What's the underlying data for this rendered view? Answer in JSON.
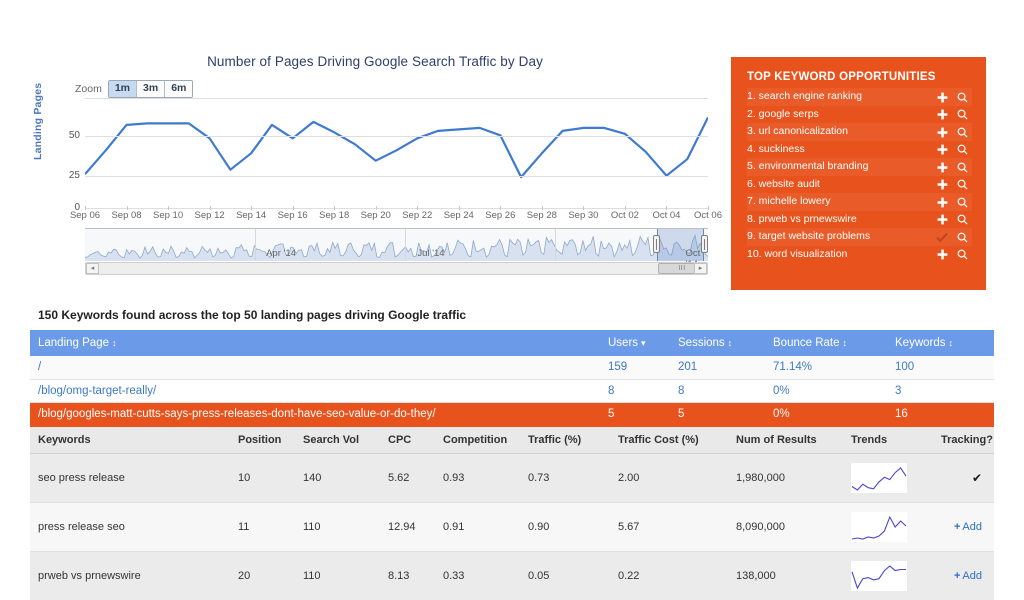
{
  "chart": {
    "title": "Number of Pages Driving Google Search Traffic by Day",
    "zoom_label": "Zoom",
    "zoom_buttons": [
      {
        "label": "1m",
        "active": true
      },
      {
        "label": "3m",
        "active": false
      },
      {
        "label": "6m",
        "active": false
      }
    ],
    "y_axis_title": "Landing Pages",
    "y_ticks": [
      "50",
      "25",
      "0"
    ],
    "navigator_labels": [
      "Apr '14",
      "Jul '14",
      "Oct '14"
    ],
    "scrollbar": {
      "left_arrow": "◂",
      "right_arrow": "▸",
      "grip": "III"
    }
  },
  "chart_data": {
    "type": "line",
    "title": "Number of Pages Driving Google Search Traffic by Day",
    "xlabel": "",
    "ylabel": "Landing Pages",
    "ylim": [
      0,
      75
    ],
    "y_ticks": [
      0,
      25,
      50
    ],
    "grid": true,
    "legend": "none",
    "x": [
      "Sep 06",
      "Sep 07",
      "Sep 08",
      "Sep 09",
      "Sep 10",
      "Sep 11",
      "Sep 12",
      "Sep 13",
      "Sep 14",
      "Sep 15",
      "Sep 16",
      "Sep 17",
      "Sep 18",
      "Sep 19",
      "Sep 20",
      "Sep 21",
      "Sep 22",
      "Sep 23",
      "Sep 24",
      "Sep 25",
      "Sep 26",
      "Sep 27",
      "Sep 28",
      "Sep 29",
      "Sep 30",
      "Oct 01",
      "Oct 02",
      "Oct 03",
      "Oct 04",
      "Oct 05",
      "Oct 06"
    ],
    "x_tick_labels": [
      "Sep 06",
      "Sep 08",
      "Sep 10",
      "Sep 12",
      "Sep 14",
      "Sep 16",
      "Sep 18",
      "Sep 20",
      "Sep 22",
      "Sep 24",
      "Sep 26",
      "Sep 28",
      "Sep 30",
      "Oct 02",
      "Oct 04",
      "Oct 06"
    ],
    "series": [
      {
        "name": "Landing Pages",
        "color": "#3e7ad1",
        "values": [
          24,
          40,
          57,
          58,
          58,
          58,
          48,
          27,
          38,
          57,
          48,
          59,
          52,
          44,
          33,
          40,
          48,
          53,
          54,
          55,
          50,
          22,
          38,
          53,
          55,
          55,
          51,
          39,
          23,
          34,
          62
        ]
      }
    ],
    "navigator": {
      "range_labels": [
        "Apr '14",
        "Jul '14",
        "Oct '14"
      ],
      "selection": "Sep 06 - Oct 06"
    }
  },
  "keyword_panel": {
    "title": "TOP KEYWORD OPPORTUNITIES",
    "items": [
      {
        "rank": "1.",
        "name": "search engine ranking",
        "action": "add",
        "search": "search-icon"
      },
      {
        "rank": "2.",
        "name": "google serps",
        "action": "add",
        "search": "search-icon"
      },
      {
        "rank": "3.",
        "name": "url canonicalization",
        "action": "add",
        "search": "search-icon"
      },
      {
        "rank": "4.",
        "name": "suckiness",
        "action": "add",
        "search": "search-icon"
      },
      {
        "rank": "5.",
        "name": "environmental branding",
        "action": "add",
        "search": "search-icon"
      },
      {
        "rank": "6.",
        "name": "website audit",
        "action": "add",
        "search": "search-icon"
      },
      {
        "rank": "7.",
        "name": "michelle lowery",
        "action": "add",
        "search": "search-icon"
      },
      {
        "rank": "8.",
        "name": "prweb vs prnewswire",
        "action": "add",
        "search": "search-icon"
      },
      {
        "rank": "9.",
        "name": "target website problems",
        "action": "tracked",
        "search": "search-icon"
      },
      {
        "rank": "10.",
        "name": "word visualization",
        "action": "add",
        "search": "search-icon"
      }
    ]
  },
  "summary": "150 Keywords found across the top 50 landing pages driving Google traffic",
  "landing_table": {
    "columns": [
      {
        "label": "Landing Page",
        "sort": "both"
      },
      {
        "label": "Users",
        "sort": "desc"
      },
      {
        "label": "Sessions",
        "sort": "both"
      },
      {
        "label": "Bounce Rate",
        "sort": "both"
      },
      {
        "label": "Keywords",
        "sort": "both"
      }
    ],
    "rows": [
      {
        "page": "/",
        "users": "159",
        "sessions": "201",
        "bounce": "71.14%",
        "keywords": "100",
        "selected": false
      },
      {
        "page": "/blog/omg-target-really/",
        "users": "8",
        "sessions": "8",
        "bounce": "0%",
        "keywords": "3",
        "selected": false
      },
      {
        "page": "/blog/googles-matt-cutts-says-press-releases-dont-have-seo-value-or-do-they/",
        "users": "5",
        "sessions": "5",
        "bounce": "0%",
        "keywords": "16",
        "selected": true
      }
    ]
  },
  "keyword_table": {
    "columns": [
      "Keywords",
      "Position",
      "Search Vol",
      "CPC",
      "Competition",
      "Traffic (%)",
      "Traffic Cost (%)",
      "Num of Results",
      "Trends",
      "Tracking?"
    ],
    "rows": [
      {
        "keyword": "seo press release",
        "position": "10",
        "search_vol": "140",
        "cpc": "5.62",
        "competition": "0.93",
        "traffic": "0.73",
        "traffic_cost": "2.00",
        "num_results": "1,980,000",
        "trend": [
          12,
          9,
          14,
          11,
          10,
          16,
          20,
          18,
          24,
          28,
          21
        ],
        "tracking": "tracked",
        "tracking_label": "✔"
      },
      {
        "keyword": "press release seo",
        "position": "11",
        "search_vol": "110",
        "cpc": "12.94",
        "competition": "0.91",
        "traffic": "0.90",
        "traffic_cost": "5.67",
        "num_results": "8,090,000",
        "trend": [
          6,
          7,
          6,
          8,
          7,
          9,
          14,
          28,
          18,
          24,
          19
        ],
        "tracking": "add",
        "tracking_label": "Add"
      },
      {
        "keyword": "prweb vs prnewswire",
        "position": "20",
        "search_vol": "110",
        "cpc": "8.13",
        "competition": "0.33",
        "traffic": "0.05",
        "traffic_cost": "0.22",
        "num_results": "138,000",
        "trend": [
          18,
          4,
          12,
          13,
          11,
          12,
          19,
          23,
          19,
          20,
          20
        ],
        "tracking": "add",
        "tracking_label": "Add"
      }
    ]
  },
  "colors": {
    "orange": "#e8531d",
    "header_blue": "#6b9be8",
    "line_blue": "#3e7ad1",
    "link_blue": "#3c7ac4"
  }
}
